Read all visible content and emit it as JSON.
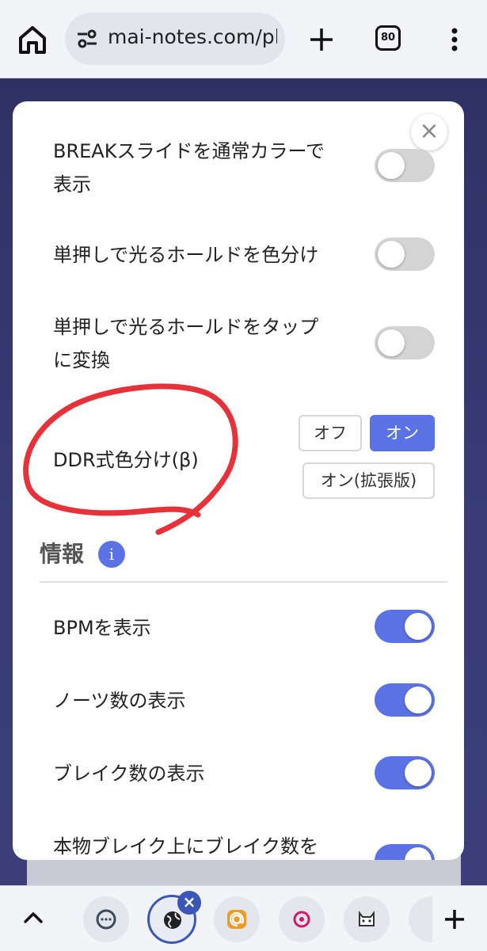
{
  "browser": {
    "url": "mai-notes.com/pl",
    "tab_count": "80"
  },
  "settings": {
    "rows": [
      {
        "label": "BREAKスライドを通常カラーで表示",
        "line1": "BREAKスライドを通常カラーで",
        "line2": "表示",
        "state": "off"
      },
      {
        "label": "単押しで光るホールドを色分け",
        "state": "off"
      },
      {
        "label": "単押しで光るホールドをタップに変換",
        "line1": "単押しで光るホールドをタップ",
        "line2": "に変換",
        "state": "off"
      }
    ],
    "ddr": {
      "label": "DDR式色分け(β)",
      "options": [
        "オフ",
        "オン",
        "オン(拡張版)"
      ],
      "selected": "オン"
    }
  },
  "info_section": {
    "title": "情報",
    "info_icon": "i",
    "rows": [
      {
        "label": "BPMを表示",
        "state": "on"
      },
      {
        "label": "ノーツ数の表示",
        "state": "on"
      },
      {
        "label": "ブレイク数の表示",
        "state": "on"
      },
      {
        "label": "本物ブレイク上にブレイク数を",
        "state": "on"
      }
    ]
  },
  "modal": {
    "close_label": "×"
  },
  "colors": {
    "accent": "#5b72e6",
    "toggle_off": "#d4d4d4",
    "annotation": "#e8323a",
    "page_background": "#2f3166"
  },
  "icons": [
    "home-icon",
    "tune-icon",
    "plus-icon",
    "more-vert-icon",
    "chevron-up-icon",
    "info-icon",
    "close-icon"
  ]
}
